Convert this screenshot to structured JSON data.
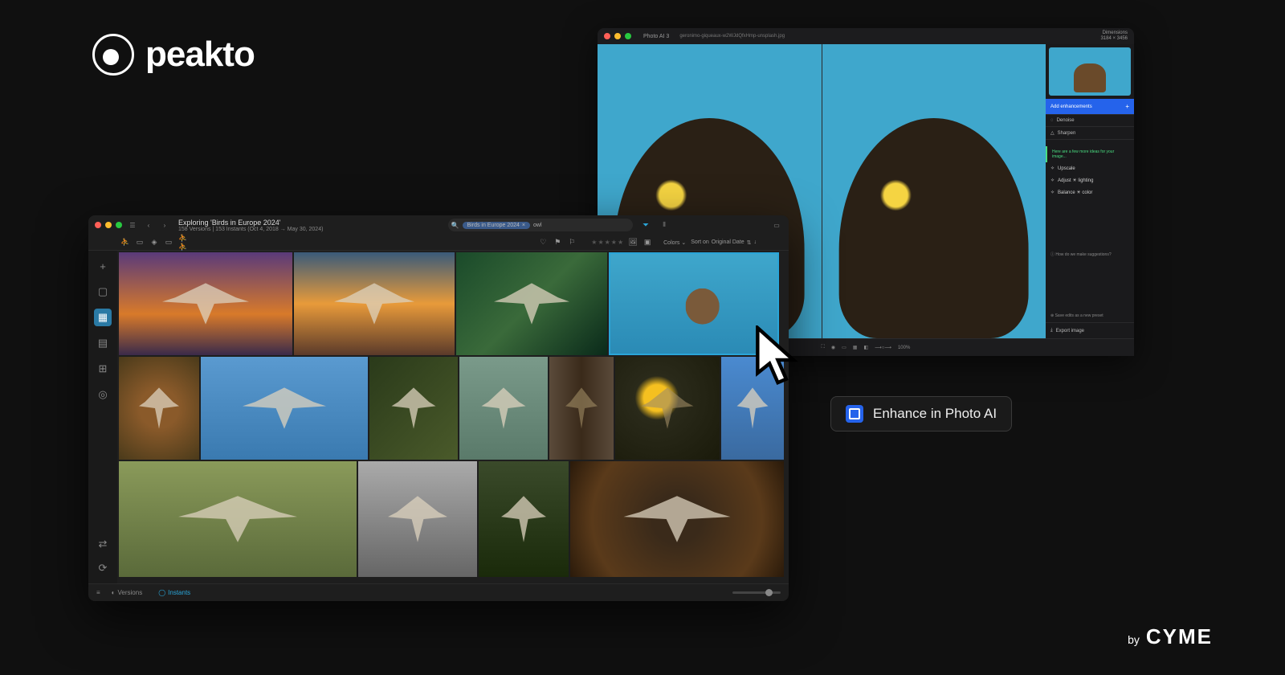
{
  "brand": {
    "name": "peakto",
    "by_prefix": "by",
    "by_name": "CYME"
  },
  "enhance_pill": "Enhance in Photo AI",
  "photoai": {
    "app_name": "Photo AI  3",
    "filename": "geronimo-giqueaux-w2WJdQfxHmp-unsplash.jpg",
    "dim_label": "Dimensions",
    "dim_value": "3184 × 3456",
    "panel": {
      "add_enhancements": "Add enhancements",
      "denoise": "Denoise",
      "sharpen": "Sharpen",
      "ideas": "Here are a few more ideas for your image...",
      "upscale": "Upscale",
      "adjust_lighting": "Adjust ☀ lighting",
      "balance_color": "Balance ☀ color",
      "how": "How do we make suggestions?",
      "save_preset": "Save edits as a new preset",
      "export": "Export image"
    },
    "zoom": "100%"
  },
  "peakto": {
    "title": "Exploring 'Birds in Europe 2024'",
    "subtitle": "158 Versions | 153 Instants (Oct 4, 2018 → May 30, 2024)",
    "search_chip": "Birds in Europe 2024",
    "search_text": "owl",
    "colors_label": "Colors",
    "sort_label": "Sort on",
    "sort_value": "Original Date",
    "footer": {
      "versions": "Versions",
      "instants": "Instants"
    }
  }
}
